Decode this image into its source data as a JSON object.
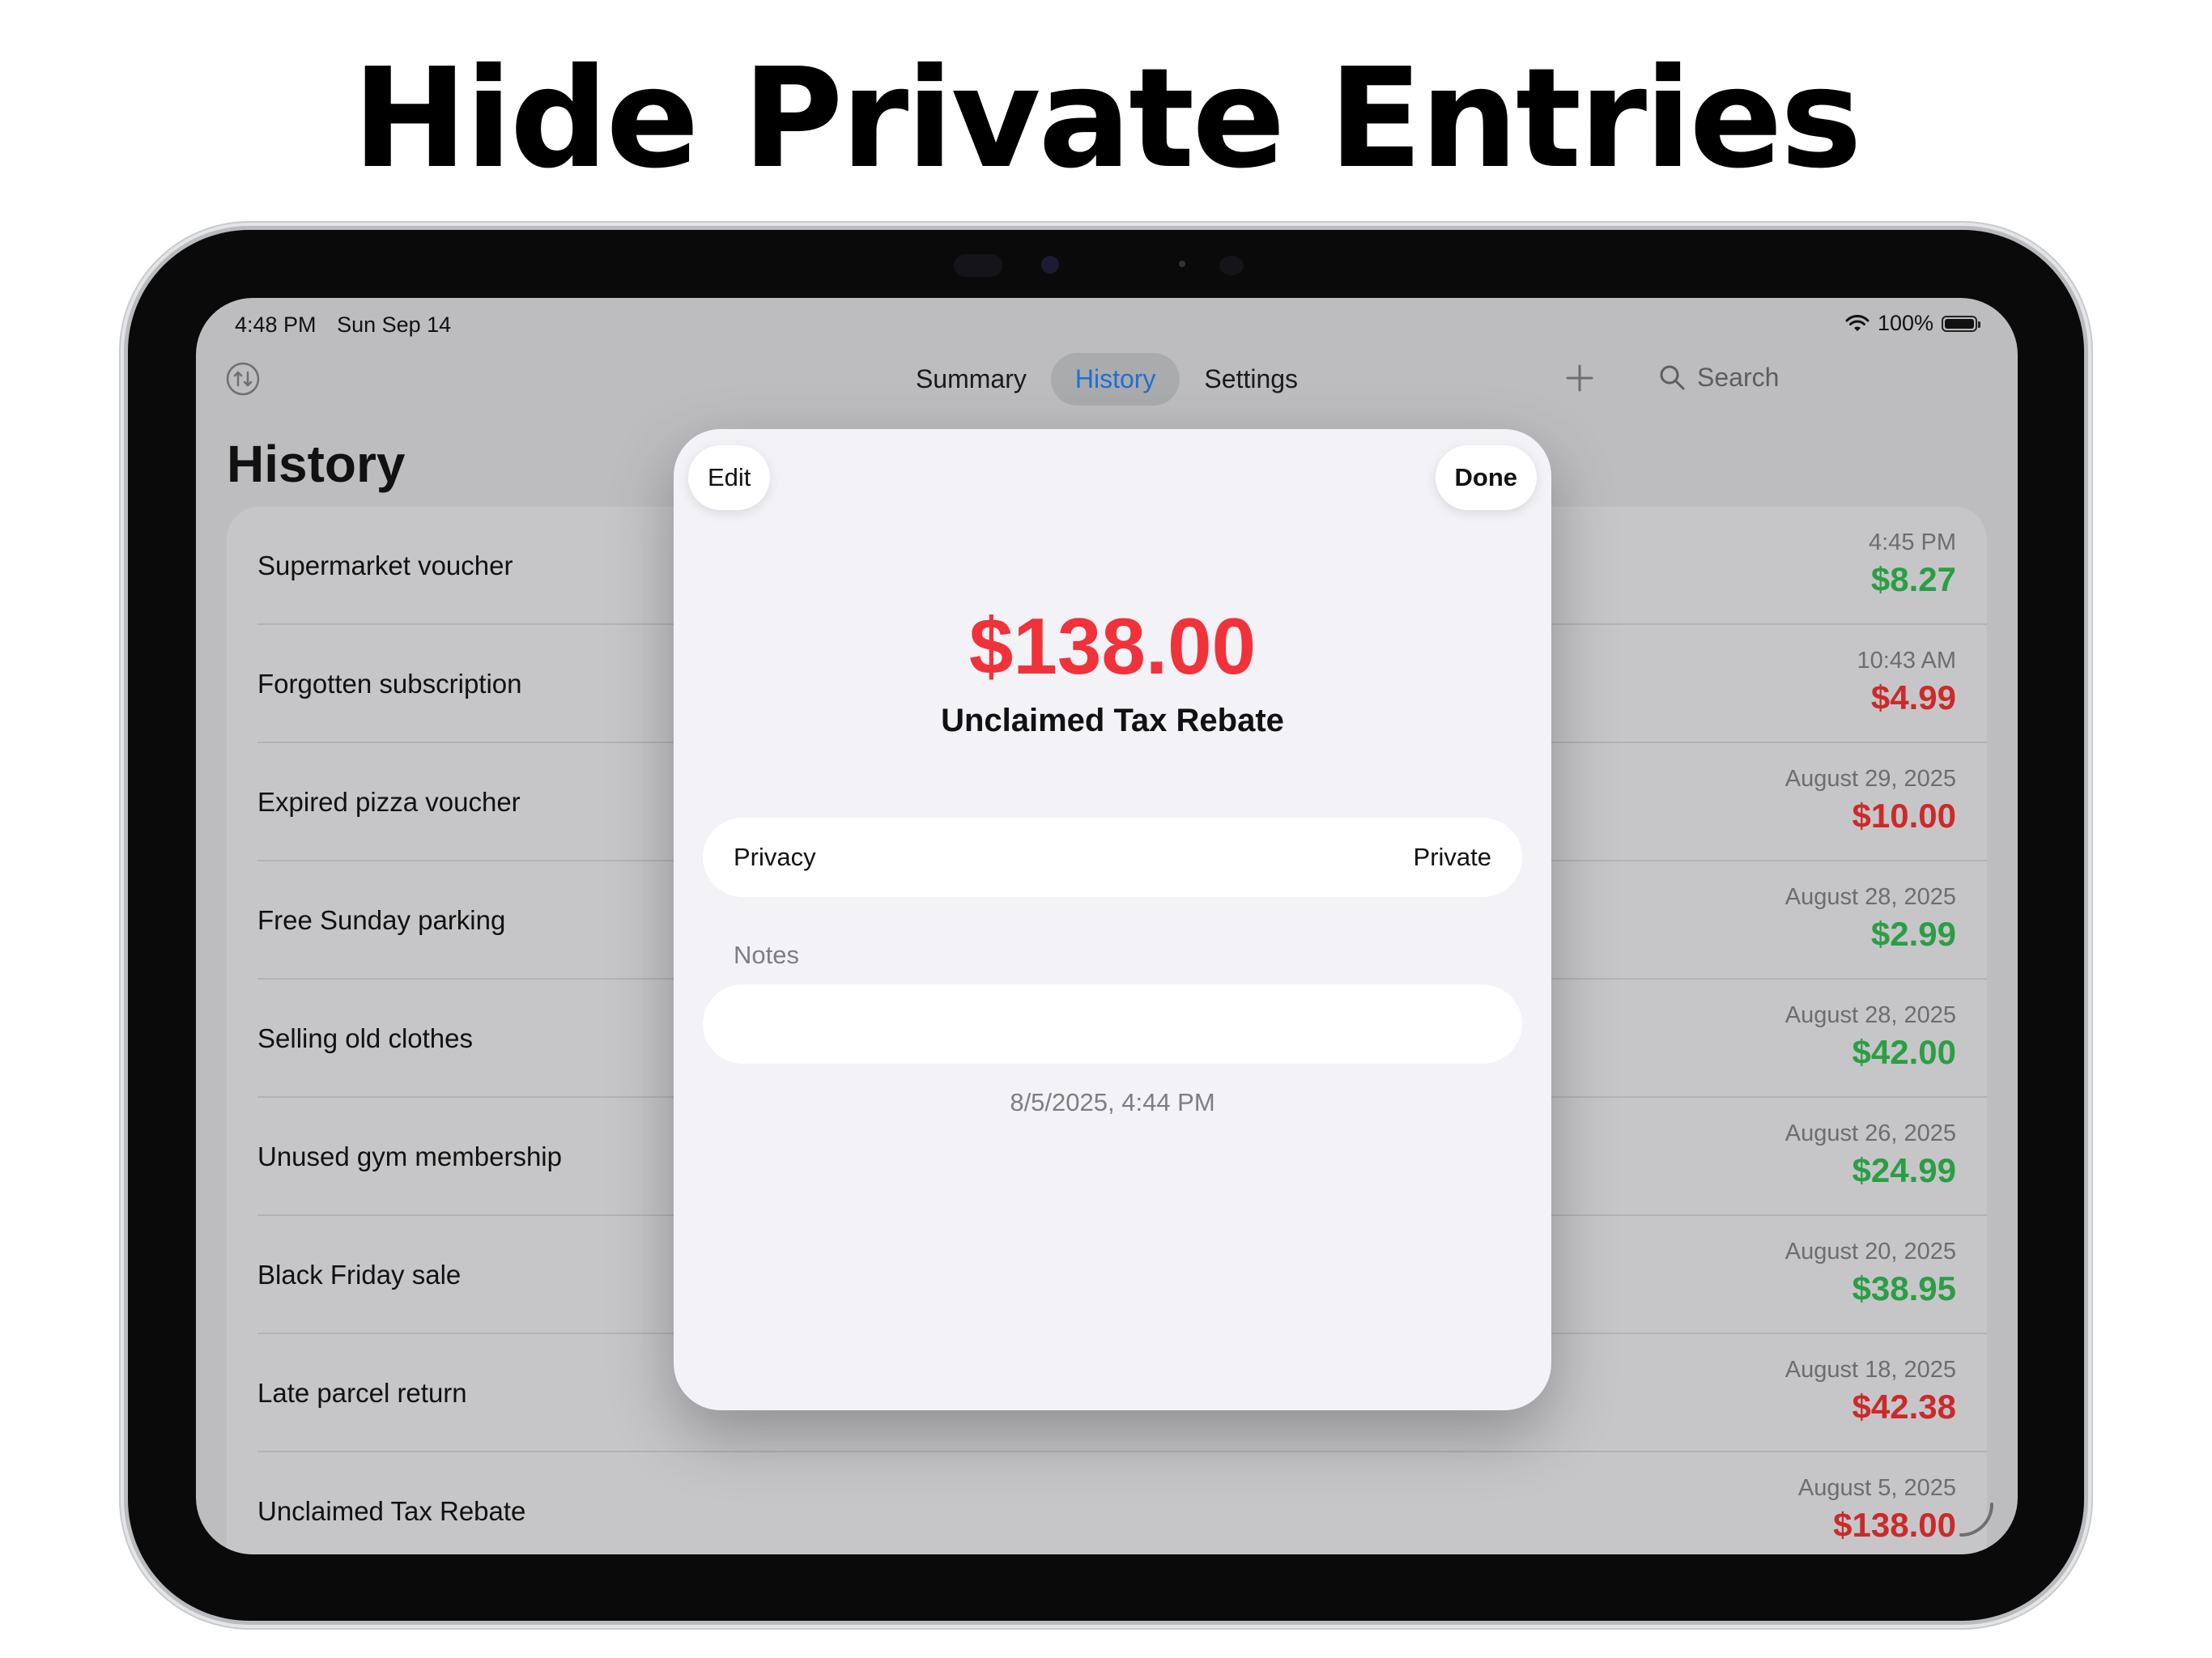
{
  "headline": "Hide Private Entries",
  "status_bar": {
    "time": "4:48 PM",
    "date": "Sun Sep 14",
    "battery": "100%"
  },
  "nav": {
    "tabs": [
      {
        "label": "Summary",
        "active": false
      },
      {
        "label": "History",
        "active": true
      },
      {
        "label": "Settings",
        "active": false
      }
    ],
    "search_placeholder": "Search",
    "accent_color": "#1f6fd1"
  },
  "page_title": "History",
  "entries": [
    {
      "name": "Supermarket voucher",
      "date": "4:45 PM",
      "amount": "$8.27",
      "type": "gain"
    },
    {
      "name": "Forgotten subscription",
      "date": "10:43 AM",
      "amount": "$4.99",
      "type": "loss"
    },
    {
      "name": "Expired pizza voucher",
      "date": "August 29, 2025",
      "amount": "$10.00",
      "type": "loss"
    },
    {
      "name": "Free Sunday parking",
      "date": "August 28, 2025",
      "amount": "$2.99",
      "type": "gain"
    },
    {
      "name": "Selling old clothes",
      "date": "August 28, 2025",
      "amount": "$42.00",
      "type": "gain"
    },
    {
      "name": "Unused gym membership",
      "date": "August 26, 2025",
      "amount": "$24.99",
      "type": "gain"
    },
    {
      "name": "Black Friday sale",
      "date": "August 20, 2025",
      "amount": "$38.95",
      "type": "gain"
    },
    {
      "name": "Late parcel return",
      "date": "August 18, 2025",
      "amount": "$42.38",
      "type": "loss"
    },
    {
      "name": "Unclaimed Tax Rebate",
      "date": "August 5, 2025",
      "amount": "$138.00",
      "type": "loss"
    }
  ],
  "colors": {
    "gain": "#2b9e45",
    "loss": "#cc2a2a",
    "modal_amount": "#f0323b"
  },
  "modal": {
    "edit_label": "Edit",
    "done_label": "Done",
    "amount": "$138.00",
    "name": "Unclaimed Tax Rebate",
    "privacy_label": "Privacy",
    "privacy_value": "Private",
    "notes_label": "Notes",
    "notes_value": "",
    "timestamp": "8/5/2025, 4:44 PM"
  }
}
